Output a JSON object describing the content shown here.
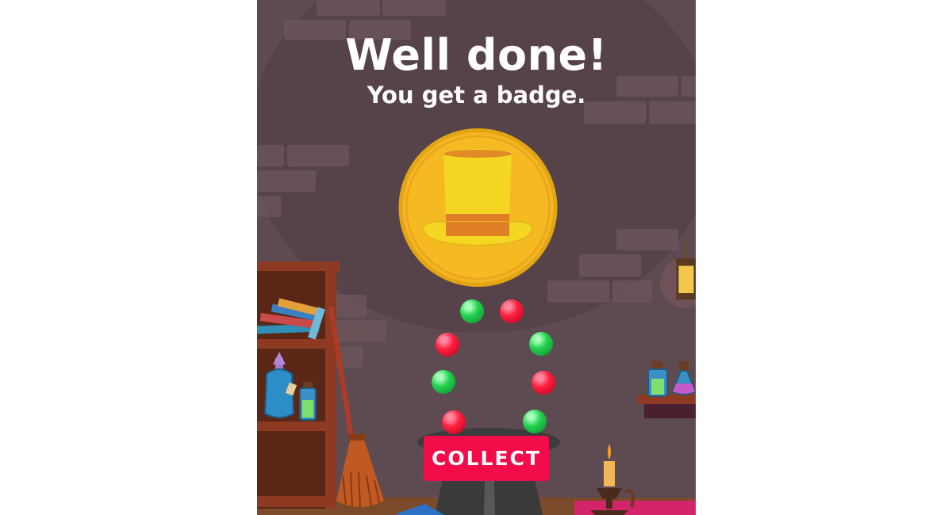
{
  "dialog": {
    "headline": "Well done!",
    "subline": "You get a badge.",
    "collect_label": "COLLECT"
  },
  "badge": {
    "icon": "top-hat-icon",
    "coin_color": "#f4b524",
    "hat_color": "#f5d623",
    "band_color": "#e07f26"
  },
  "colors": {
    "background_wall": "#5e4b52",
    "button": "#f20d4a",
    "orb_red": "#ff1f3e",
    "orb_green": "#22d14f"
  },
  "orbs": [
    "green",
    "red",
    "red",
    "green",
    "green",
    "red",
    "red",
    "green"
  ]
}
